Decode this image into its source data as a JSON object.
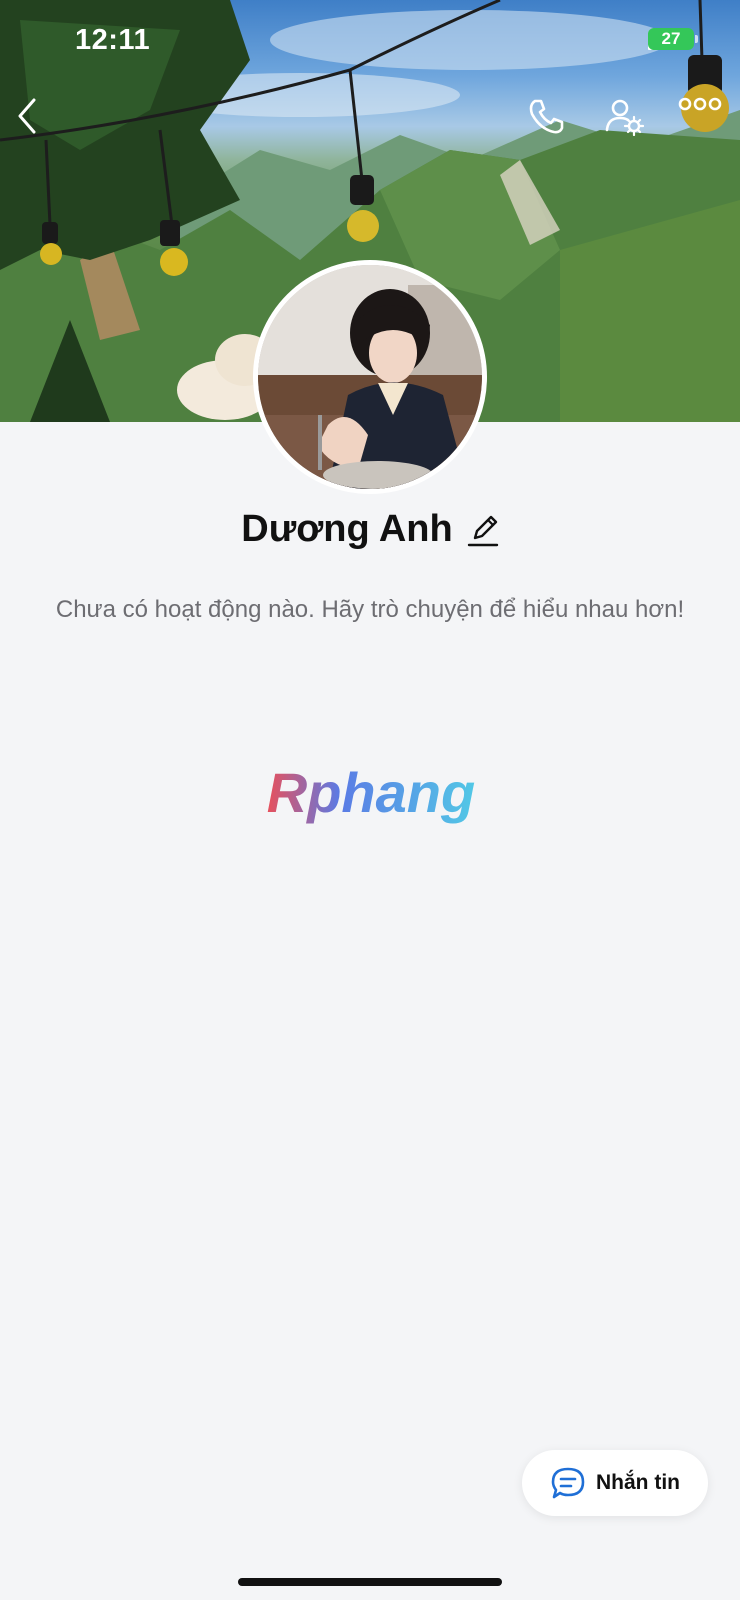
{
  "status_bar": {
    "time": "12:11",
    "battery": "27"
  },
  "header": {
    "back_icon": "chevron-left-icon",
    "call_icon": "phone-icon",
    "profile_settings_icon": "user-gear-icon",
    "more_icon": "more-dots-icon"
  },
  "profile": {
    "name": "Dương Anh",
    "edit_icon": "pencil-icon",
    "empty_message": "Chưa có hoạt động nào. Hãy trò chuyện để hiểu nhau hơn!"
  },
  "watermark": {
    "text": "Rphang"
  },
  "message_button": {
    "label": "Nhắn tin",
    "icon": "chat-bubble-icon"
  },
  "colors": {
    "background": "#f4f5f7",
    "accent_blue": "#1f6fd6",
    "battery_green": "#34c759"
  }
}
